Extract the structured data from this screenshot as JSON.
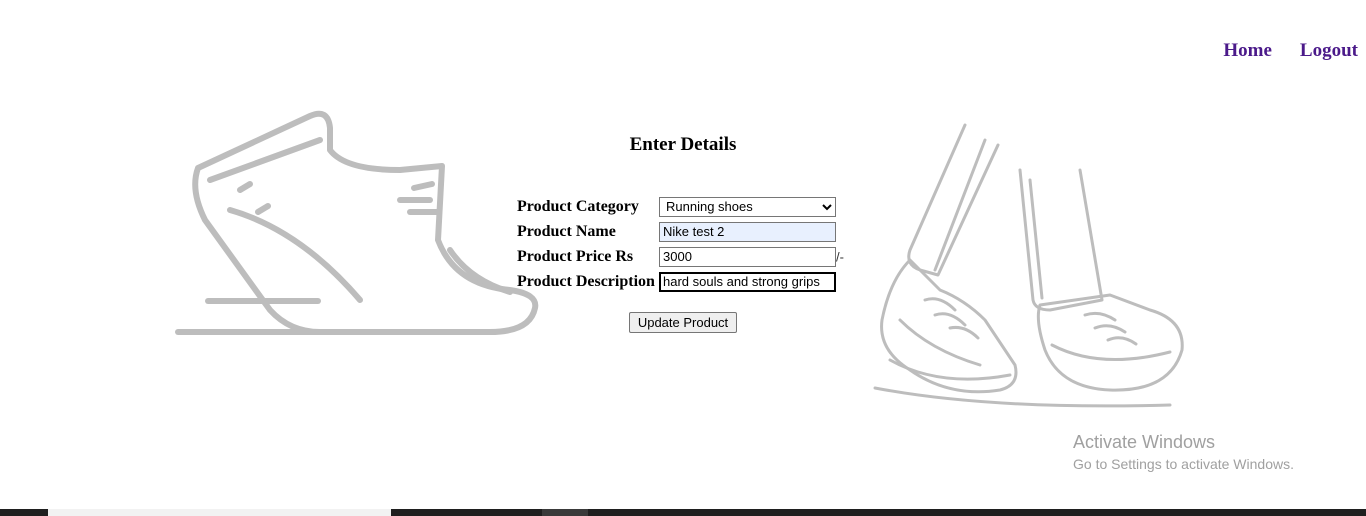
{
  "nav": {
    "home": "Home",
    "logout": "Logout"
  },
  "form": {
    "title": "Enter Details",
    "category_label": "Product Category",
    "category_value": "Running shoes",
    "name_label": "Product Name",
    "name_value": "Nike test 2",
    "price_label": "Product Price Rs",
    "price_value": "3000",
    "price_suffix": "/-",
    "description_label": "Product Description",
    "description_value": "hard souls and strong grips",
    "submit_label": "Update Product"
  },
  "watermark": {
    "line1": "Activate Windows",
    "line2": "Go to Settings to activate Windows."
  },
  "colors": {
    "nav_link": "#4b1a8a",
    "illustration": "#bdbdbd"
  },
  "icons": {
    "left_illustration": "running-shoe-icon",
    "right_illustration": "walking-feet-icon"
  }
}
